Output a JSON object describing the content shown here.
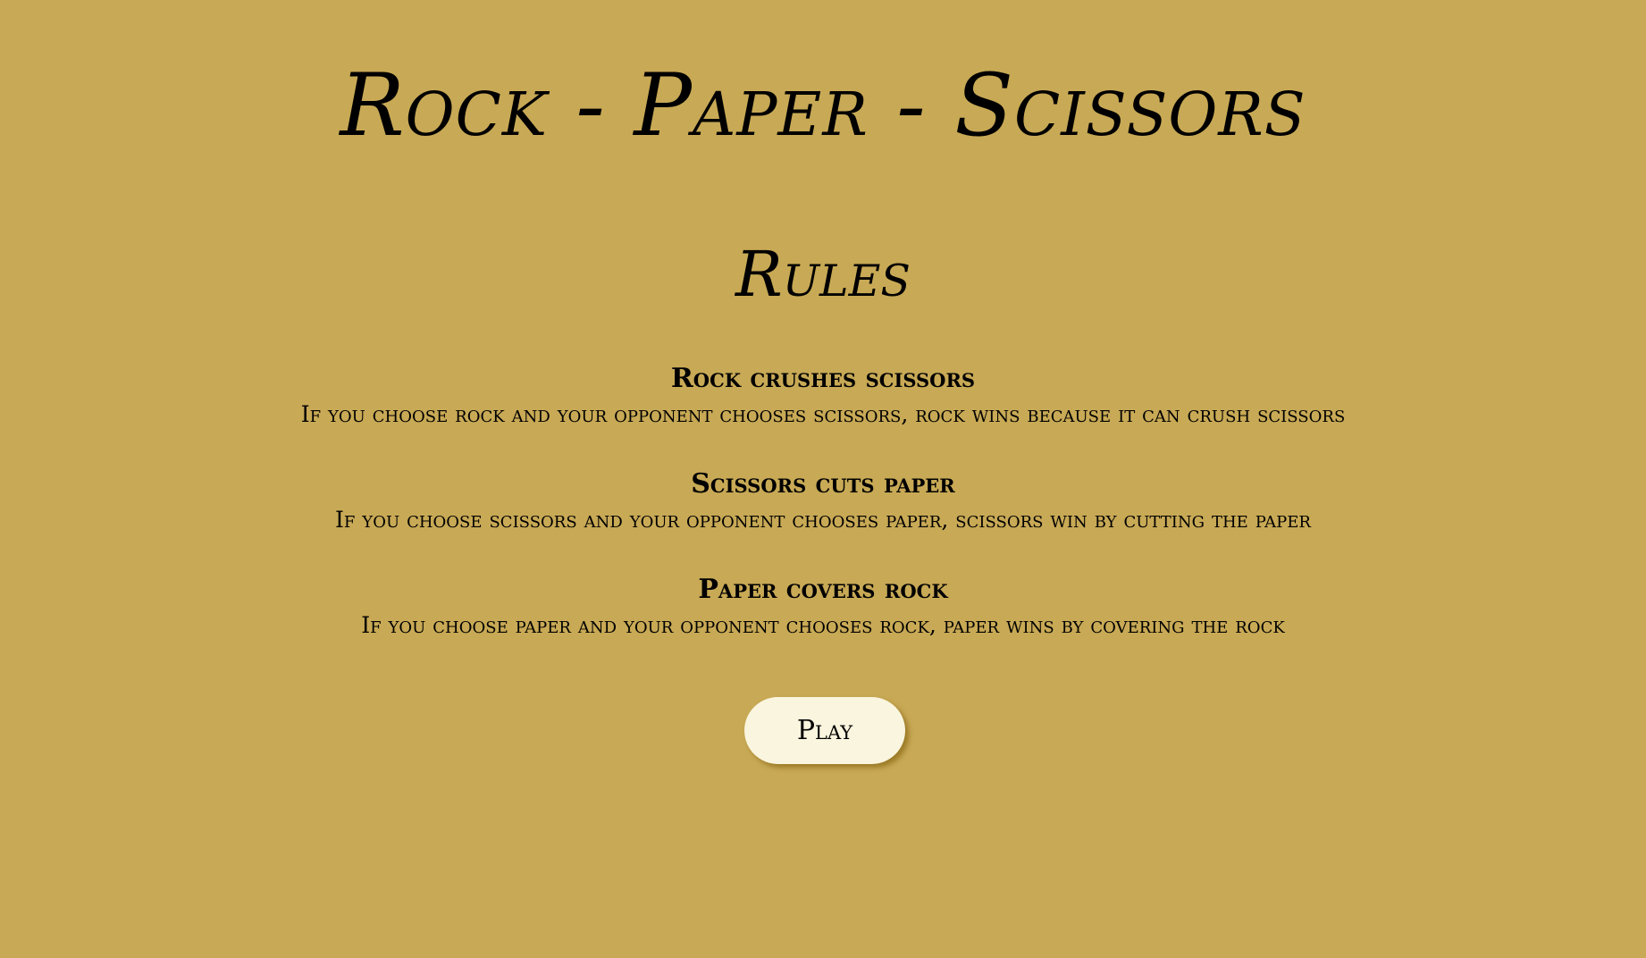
{
  "page": {
    "title": "Rock - Paper - Scissors",
    "rules_heading": "Rules"
  },
  "rules": [
    {
      "title": "Rock crushes scissors",
      "text": "If you choose rock and your opponent chooses scissors, rock wins because it can crush scissors"
    },
    {
      "title": "Scissors cuts paper",
      "text": "If you choose scissors and your opponent chooses paper, scissors win by cutting the paper"
    },
    {
      "title": "Paper covers rock",
      "text": "If you choose paper and your opponent chooses rock, paper wins by covering the rock"
    }
  ],
  "actions": {
    "play_label": "Play"
  },
  "colors": {
    "background": "#c8a955",
    "button_background": "#faf5de",
    "text": "#000000"
  }
}
